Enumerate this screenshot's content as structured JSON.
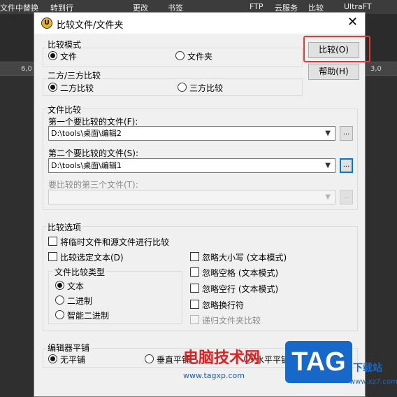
{
  "background": {
    "toolbar_items": [
      "文件中替换",
      "转到行",
      "更改",
      "书签",
      "FTP",
      "云服务",
      "比较",
      "UltraFT"
    ],
    "ruler_labels": [
      "6,0",
      "3,0"
    ]
  },
  "dialog": {
    "title": "比较文件/文件夹",
    "close_glyph": "✕",
    "compare_mode": {
      "title": "比较模式",
      "options": [
        "文件",
        "文件夹"
      ],
      "selected": "文件"
    },
    "way_compare": {
      "title": "二方/三方比较",
      "options": [
        "二方比较",
        "三方比较"
      ],
      "selected": "二方比较"
    },
    "buttons": {
      "compare": "比较(O)",
      "help": "帮助(H)"
    },
    "file_compare": {
      "title": "文件比较",
      "first_label": "第一个要比较的文件(F):",
      "first_value": "D:\\tools\\桌面\\编辑2",
      "second_label": "第二个要比较的文件(S):",
      "second_value": "D:\\tools\\桌面\\编辑1",
      "third_label": "要比较的第三个文件(T):",
      "third_value": "",
      "browse": "..."
    },
    "compare_options": {
      "title": "比较选项",
      "temp_with_source": "将临时文件和源文件进行比较",
      "compare_selected": "比较选定文本(D)",
      "ignore_case": "忽略大小写 (文本模式)",
      "ignore_spaces": "忽略空格 (文本模式)",
      "ignore_blank_lines": "忽略空行 (文本模式)",
      "ignore_line_endings": "忽略换行符",
      "recursive": "递归文件夹比较",
      "type_group": {
        "title": "文件比较类型",
        "options": [
          "文本",
          "二进制",
          "智能二进制"
        ],
        "selected": "文本"
      }
    },
    "tiling": {
      "title": "编辑器平铺",
      "options": [
        "无平铺",
        "垂直平铺",
        "水平平铺"
      ],
      "selected": "无平铺"
    }
  },
  "watermark": {
    "text": "电脑技术网",
    "url": "www.tagxp.com",
    "tag": "TAG",
    "side": "下载站",
    "side_url": "www.xz7.com"
  },
  "colors": {
    "highlight": "#e53935",
    "watermark_red": "#e02020",
    "watermark_blue": "#1668c9"
  }
}
